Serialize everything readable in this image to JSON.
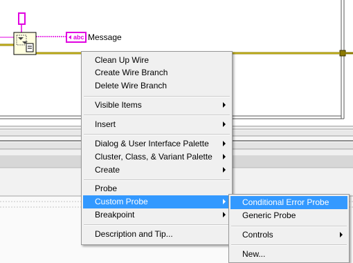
{
  "diagram": {
    "message_label": "Message",
    "string_constant_tag": "abc"
  },
  "context_menu": {
    "items": [
      {
        "label": "Clean Up Wire"
      },
      {
        "label": "Create Wire Branch"
      },
      {
        "label": "Delete Wire Branch"
      },
      {
        "label": "Visible Items"
      },
      {
        "label": "Insert"
      },
      {
        "label": "Dialog & User Interface Palette"
      },
      {
        "label": "Cluster, Class, & Variant Palette"
      },
      {
        "label": "Create"
      },
      {
        "label": "Probe"
      },
      {
        "label": "Custom Probe"
      },
      {
        "label": "Breakpoint"
      },
      {
        "label": "Description and Tip..."
      }
    ]
  },
  "submenu": {
    "items": [
      {
        "label": "Conditional Error Probe"
      },
      {
        "label": "Generic Probe"
      },
      {
        "label": "Controls"
      },
      {
        "label": "New..."
      }
    ]
  },
  "colors": {
    "menu_bg": "#f0f0f0",
    "highlight": "#3399ff",
    "string_wire": "#e000e0",
    "error_wire": "#8c7a00"
  }
}
